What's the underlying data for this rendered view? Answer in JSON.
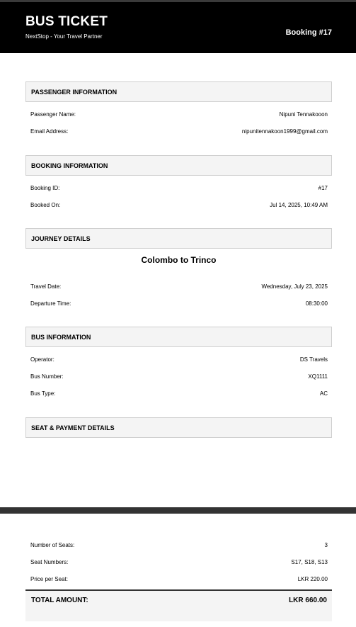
{
  "header": {
    "title": "BUS TICKET",
    "subtitle": "NextStop - Your Travel Partner",
    "booking": "Booking #17"
  },
  "passenger": {
    "title": "PASSENGER INFORMATION",
    "name_label": "Passenger Name:",
    "name_value": "Nipuni Tennakooon",
    "email_label": "Email Address:",
    "email_value": "nipunitennakoon1999@gmail.com"
  },
  "booking": {
    "title": "BOOKING INFORMATION",
    "id_label": "Booking ID:",
    "id_value": "#17",
    "booked_label": "Booked On:",
    "booked_value": "Jul 14, 2025, 10:49 AM"
  },
  "journey": {
    "title": "JOURNEY DETAILS",
    "route": "Colombo to Trinco",
    "date_label": "Travel Date:",
    "date_value": "Wednesday, July 23, 2025",
    "time_label": "Departure Time:",
    "time_value": "08:30:00"
  },
  "bus": {
    "title": "BUS INFORMATION",
    "operator_label": "Operator:",
    "operator_value": "DS Travels",
    "number_label": "Bus Number:",
    "number_value": "XQ1111",
    "type_label": "Bus Type:",
    "type_value": "AC"
  },
  "seat": {
    "title": "SEAT & PAYMENT DETAILS",
    "count_label": "Number of Seats:",
    "count_value": "3",
    "numbers_label": "Seat Numbers:",
    "numbers_value": "S17, S18, S13",
    "price_label": "Price per Seat:",
    "price_value": "LKR 220.00",
    "total_label": "TOTAL AMOUNT:",
    "total_value": "LKR 660.00"
  }
}
